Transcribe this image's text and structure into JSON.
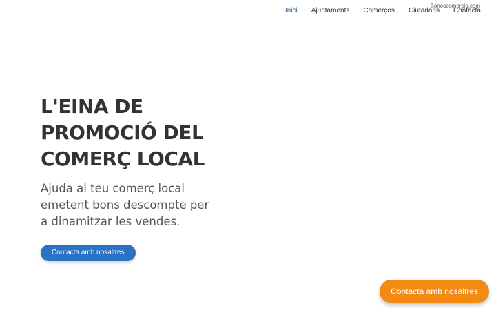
{
  "header": {
    "brand": "Bonoscomercio.com",
    "nav": [
      {
        "label": "Inici",
        "active": true
      },
      {
        "label": "Ajuntaments",
        "active": false
      },
      {
        "label": "Comerços",
        "active": false
      },
      {
        "label": "Ciutadans",
        "active": false
      },
      {
        "label": "Contacta",
        "active": false
      }
    ]
  },
  "hero": {
    "title": "L'EINA DE\nPROMOCIÓ DEL\nCOMERÇ LOCAL",
    "subtitle": "Ajuda al teu comerç local emetent bons descompte per a dinamitzar les vendes.",
    "cta_label": "Contacta amb nosaltres"
  },
  "floating_cta": {
    "label": "Contacta amb nosaltres"
  },
  "colors": {
    "primary_blue": "#2a72c3",
    "accent_orange": "#f28a14",
    "text_dark": "#333333"
  }
}
